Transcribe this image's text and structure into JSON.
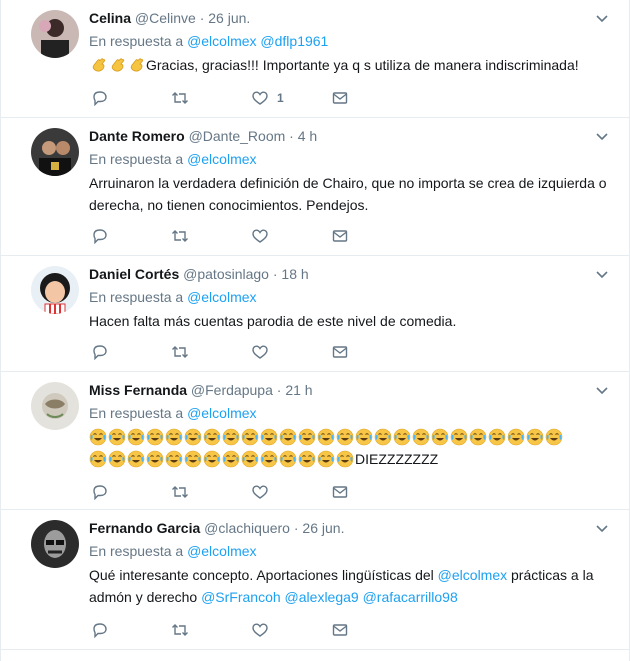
{
  "tweets": [
    {
      "name": "Celina",
      "handle": "@Celinve",
      "time": "26 jun.",
      "reply_prefix": "En respuesta a",
      "reply_mentions": [
        "@elcolmex",
        "@dflp1961"
      ],
      "text": "Gracias, gracias!!! Importante ya q s utiliza de manera indiscriminada!",
      "emoji": "clapping-hands",
      "emoji_count": 3,
      "likes": "1"
    },
    {
      "name": "Dante Romero",
      "handle": "@Dante_Room",
      "time": "4 h",
      "reply_prefix": "En respuesta a",
      "reply_mentions": [
        "@elcolmex"
      ],
      "text": "Arruinaron la verdadera definición de Chairo, que no importa se crea de izquierda o derecha, no tienen conocimientos. Pendejos."
    },
    {
      "name": "Daniel Cortés",
      "handle": "@patosinlago",
      "time": "18 h",
      "reply_prefix": "En respuesta a",
      "reply_mentions": [
        "@elcolmex"
      ],
      "text": "Hacen falta más cuentas parodia de este nivel de comedia."
    },
    {
      "name": "Miss Fernanda",
      "handle": "@Ferdapupa",
      "time": "21 h",
      "reply_prefix": "En respuesta a",
      "reply_mentions": [
        "@elcolmex"
      ],
      "emoji": "face-with-tears-of-joy",
      "emoji_count_line1": 25,
      "emoji_count_line2": 14,
      "text": "DIEZZZZZZZ"
    },
    {
      "name": "Fernando Garcia",
      "handle": "@clachiquero",
      "time": "26 jun.",
      "reply_prefix": "En respuesta a",
      "reply_mentions": [
        "@elcolmex"
      ],
      "text_parts": {
        "a": "Qué interesante concepto. Aportaciones lingüísticas del ",
        "m1": "@elcolmex",
        "b": " prácticas a la admón y derecho ",
        "m2": "@SrFrancoh",
        "m3": "@alexlega9",
        "m4": "@rafacarrillo98"
      }
    }
  ],
  "colors": {
    "accent": "#1da1f2",
    "muted": "#657786",
    "text": "#14171a",
    "border": "#e6ecf0"
  },
  "icons": [
    "reply-icon",
    "retweet-icon",
    "like-icon",
    "direct-message-icon",
    "chevron-down-icon"
  ]
}
